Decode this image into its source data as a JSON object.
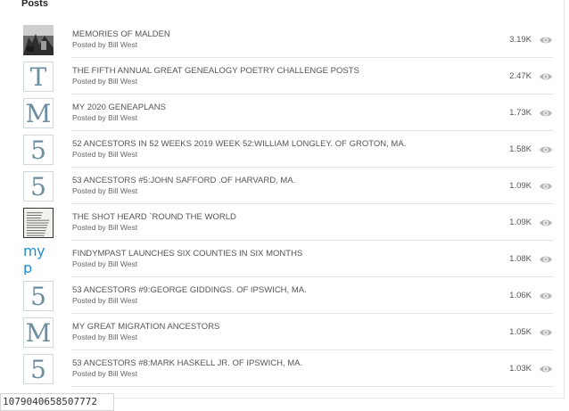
{
  "widget": {
    "title": "Posts"
  },
  "posts": [
    {
      "title": "MEMORIES OF MALDEN",
      "author": "Posted by Bill West",
      "views": "3.19K",
      "thumb": "photo1",
      "letter": ""
    },
    {
      "title": "THE FIFTH ANNUAL GREAT GENEALOGY POETRY CHALLENGE POSTS",
      "author": "Posted by Bill West",
      "views": "2.47K",
      "thumb": "letter",
      "letter": "T"
    },
    {
      "title": "MY 2020 GENEAPLANS",
      "author": "Posted by Bill West",
      "views": "1.73K",
      "thumb": "letter",
      "letter": "M"
    },
    {
      "title": "52 ANCESTORS IN 52 WEEKS 2019 WEEK 52:WILLIAM LONGLEY. OF GROTON, MA.",
      "author": "Posted by Bill West",
      "views": "1.58K",
      "thumb": "letter",
      "letter": "5"
    },
    {
      "title": "53 ANCESTORS #5:JOHN SAFFORD .OF HARVARD, MA.",
      "author": "Posted by Bill West",
      "views": "1.09K",
      "thumb": "letter",
      "letter": "5"
    },
    {
      "title": "THE SHOT HEARD `ROUND THE WORLD",
      "author": "Posted by Bill West",
      "views": "1.09K",
      "thumb": "photo2",
      "letter": ""
    },
    {
      "title": "FINDYMPAST LAUNCHES SIX COUNTIES IN SIX MONTHS",
      "author": "Posted by Bill West",
      "views": "1.08K",
      "thumb": "brand",
      "letter": "my p"
    },
    {
      "title": "53 ANCESTORS #9:GEORGE GIDDINGS. OF IPSWICH, MA.",
      "author": "Posted by Bill West",
      "views": "1.06K",
      "thumb": "letter",
      "letter": "5"
    },
    {
      "title": "MY GREAT MIGRATION ANCESTORS",
      "author": "Posted by Bill West",
      "views": "1.05K",
      "thumb": "letter",
      "letter": "M"
    },
    {
      "title": "53 ANCESTORS #8:MARK HASKELL JR. OF IPSWICH, MA.",
      "author": "Posted by Bill West",
      "views": "1.03K",
      "thumb": "letter",
      "letter": "5"
    }
  ],
  "icons": {
    "views": "eye-icon"
  },
  "colors": {
    "letter": "#6d8ea0",
    "brand": "#1f8dd6",
    "separator": "#e3e3e3"
  },
  "footer": {
    "fragment": "1079040658507772"
  }
}
